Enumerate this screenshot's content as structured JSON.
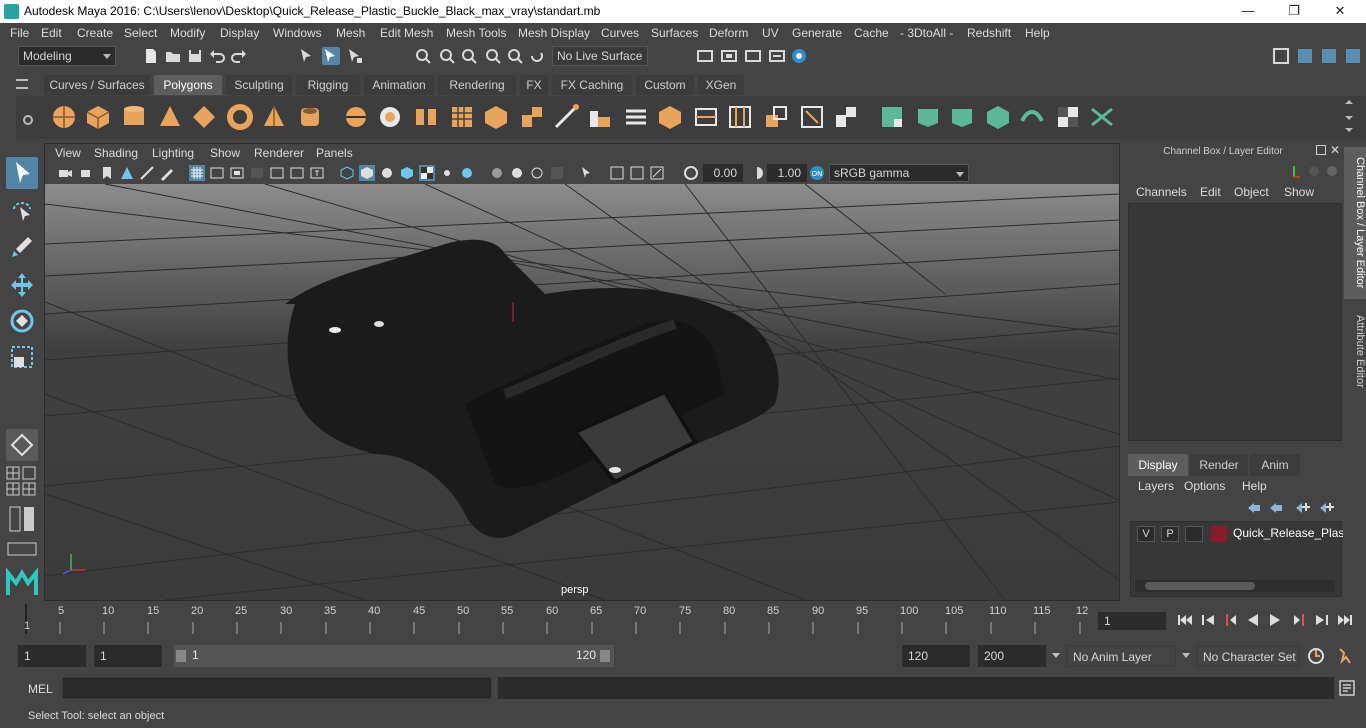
{
  "window": {
    "title": "Autodesk Maya 2016: C:\\Users\\lenov\\Desktop\\Quick_Release_Plastic_Buckle_Black_max_vray\\standart.mb",
    "minimize": "—",
    "restore": "❐",
    "close": "✕"
  },
  "menu": [
    "File",
    "Edit",
    "Create",
    "Select",
    "Modify",
    "Display",
    "Windows",
    "Mesh",
    "Edit Mesh",
    "Mesh Tools",
    "Mesh Display",
    "Curves",
    "Surfaces",
    "Deform",
    "UV",
    "Generate",
    "Cache",
    "- 3DtoAll -",
    "Redshift",
    "Help"
  ],
  "status": {
    "mode": "Modeling",
    "live_surface": "No Live Surface"
  },
  "shelf_tabs": [
    "Curves / Surfaces",
    "Polygons",
    "Sculpting",
    "Rigging",
    "Animation",
    "Rendering",
    "FX",
    "FX Caching",
    "Custom",
    "XGen"
  ],
  "active_shelf_tab": "Polygons",
  "viewport": {
    "menu": [
      "View",
      "Shading",
      "Lighting",
      "Show",
      "Renderer",
      "Panels"
    ],
    "exposure": "0.00",
    "gamma": "1.00",
    "color_space": "sRGB gamma",
    "camera_label": "persp"
  },
  "channel_box": {
    "title": "Channel Box / Layer Editor",
    "menu": [
      "Channels",
      "Edit",
      "Object",
      "Show"
    ]
  },
  "layer_editor": {
    "tabs": [
      "Display",
      "Render",
      "Anim"
    ],
    "active_tab": "Display",
    "menu": [
      "Layers",
      "Options",
      "Help"
    ],
    "layer": {
      "visible": "V",
      "playback": "P",
      "name": "Quick_Release_Plastic_Buckle_Black",
      "color": "#8a1a2a"
    }
  },
  "side_tabs": [
    "Channel Box / Layer Editor",
    "Attribute Editor"
  ],
  "timeline": {
    "ticks": [
      "1",
      "5",
      "10",
      "15",
      "20",
      "25",
      "30",
      "35",
      "40",
      "45",
      "50",
      "55",
      "60",
      "65",
      "70",
      "75",
      "80",
      "85",
      "90",
      "95",
      "100",
      "105",
      "110",
      "115",
      "12"
    ],
    "current_frame": "1"
  },
  "range": {
    "start": "1",
    "playback_start": "1",
    "slider_start": "1",
    "slider_end": "120",
    "playback_end": "120",
    "end": "200",
    "anim_layer": "No Anim Layer",
    "character_set": "No Character Set"
  },
  "command": {
    "label": "MEL",
    "value": ""
  },
  "help_line": "Select Tool: select an object",
  "colors": {
    "accent": "#5285a6",
    "shelf_icon": "#e8a35c",
    "layer_color": "#8a1a2a"
  }
}
